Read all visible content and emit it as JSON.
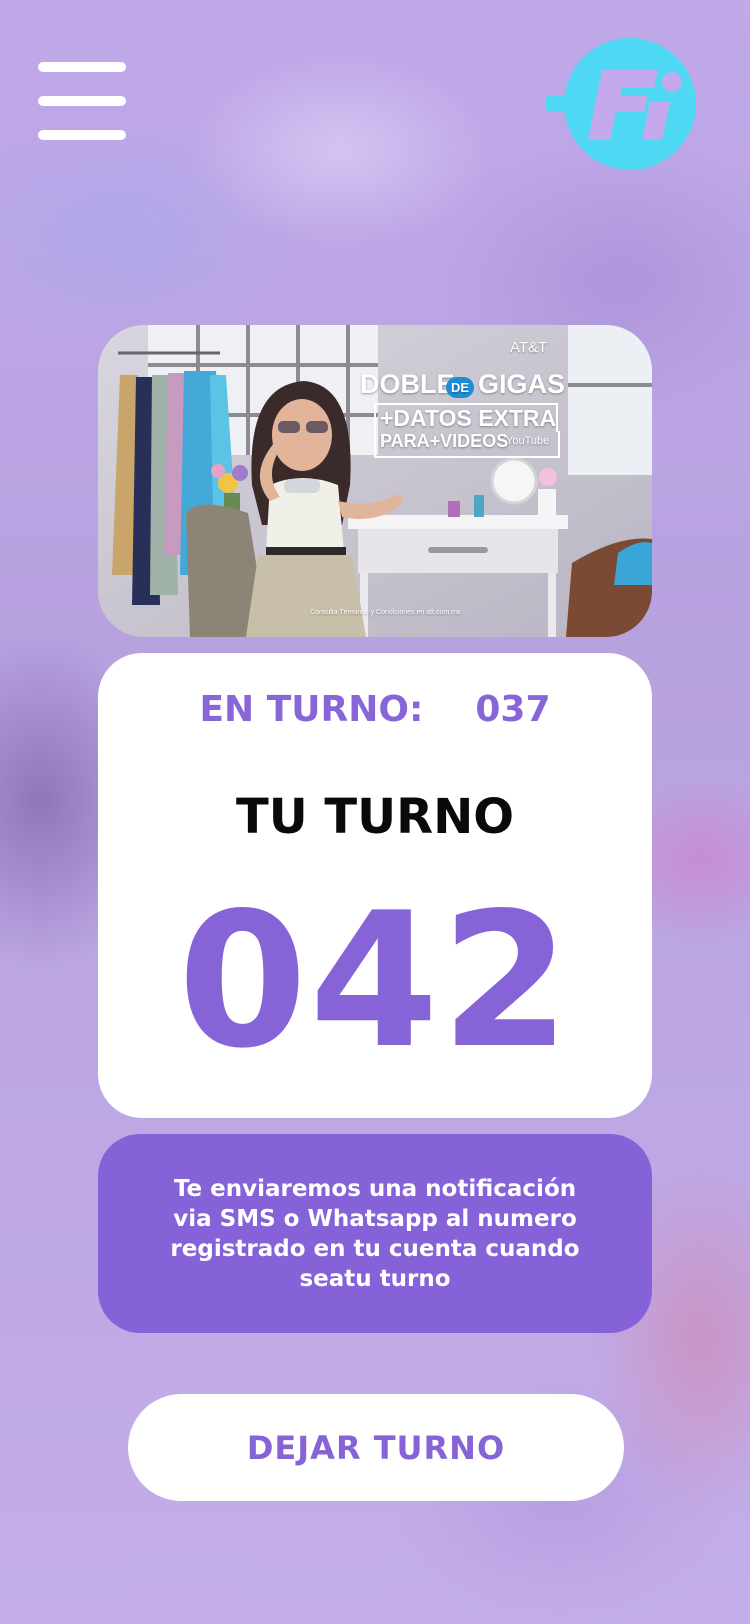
{
  "colors": {
    "background": "#c1aae8",
    "accent_purple": "#8763d8",
    "logo_cyan": "#4fd8f4",
    "card_white": "#ffffff"
  },
  "header": {
    "menu_icon": "hamburger-menu-icon",
    "logo_icon": "fi-brand-logo"
  },
  "promo": {
    "brand": "AT&T",
    "line1_left": "DOBLE",
    "line1_mid": "DE",
    "line1_right": "GIGAS",
    "line2": "+DATOS EXTRA",
    "line3": "PARA+VIDEOS",
    "line3_brand": "YouTube",
    "disclaimer": "Consulta Términos y Condiciones en att.com.mx"
  },
  "turn_card": {
    "current_label": "EN TURNO:",
    "current_number": "037",
    "your_turn_label": "TU TURNO",
    "your_number": "042"
  },
  "notice": {
    "text": "Te enviaremos una notificación via SMS o Whatsapp al numero registrado en tu cuenta cuando seatu turno"
  },
  "actions": {
    "leave_label": "DEJAR TURNO"
  }
}
